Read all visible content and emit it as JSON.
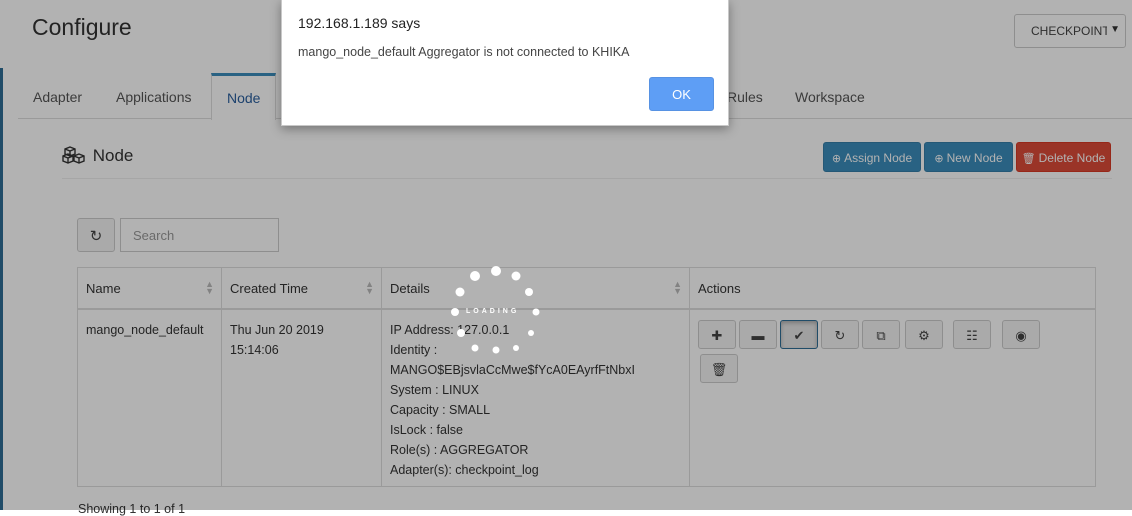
{
  "page": {
    "title": "Configure"
  },
  "checkpoint_dropdown": {
    "selected": "CHECKPOINT"
  },
  "tabs": [
    {
      "label": "Adapter"
    },
    {
      "label": "Applications"
    },
    {
      "label": "Node"
    },
    {
      "label": "Rules"
    },
    {
      "label": "Workspace"
    }
  ],
  "panel": {
    "title": "Node",
    "buttons": {
      "assign": "Assign Node",
      "new": "New Node",
      "delete": "Delete Node"
    }
  },
  "search": {
    "placeholder": "Search"
  },
  "table": {
    "columns": [
      "Name",
      "Created Time",
      "Details",
      "Actions"
    ],
    "row": {
      "name": "mango_node_default",
      "created_date": "Thu Jun 20 2019",
      "created_time": "15:14:06",
      "details": [
        "IP Address: 127.0.0.1",
        "Identity :",
        "MANGO$EBjsvlaCcMwe$fYcA0EAyrfFtNbxI",
        "System : LINUX",
        "Capacity : SMALL",
        "IsLock : false",
        "Role(s) : AGGREGATOR",
        "Adapter(s): checkpoint_log"
      ]
    }
  },
  "footer": {
    "showing": "Showing 1 to 1 of 1"
  },
  "loader": {
    "text": "LOADING"
  },
  "dialog": {
    "title": "192.168.1.189 says",
    "message": "mango_node_default Aggregator is not connected to KHIKA",
    "ok": "OK"
  },
  "colors": {
    "accent": "#3c8dbc",
    "danger": "#dd4b39",
    "dialog_button": "#5e9ef5",
    "overlay": "rgba(0,0,0,0.30)"
  }
}
